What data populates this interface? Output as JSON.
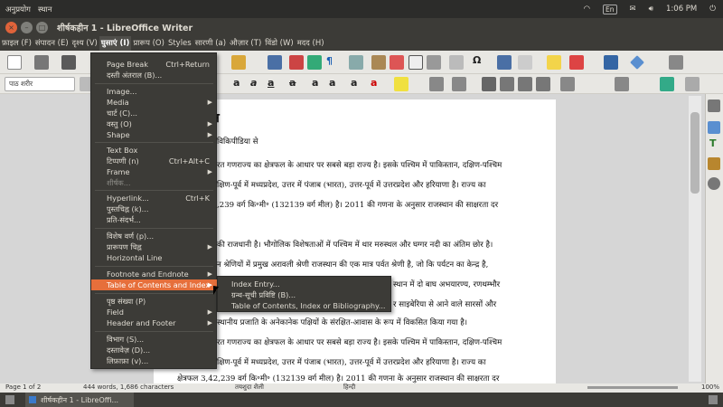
{
  "topbar": {
    "app_menu_1": "अनुप्रयोग",
    "app_menu_2": "स्थान",
    "keyboard": "En",
    "time": "1:06 PM"
  },
  "window": {
    "title": "शीर्षकहीन 1 - LibreOffice Writer"
  },
  "menubar": [
    "फ़ाइल (F)",
    "संपादन (E)",
    "दृश्य (V)",
    "घुसाएं (I)",
    "प्रारूप (O)",
    "Styles",
    "सारणी (a)",
    "औज़ार (T)",
    "विंडो (W)",
    "मदद (H)"
  ],
  "toolbar": {
    "paragraph_style": "पाठ शरीर"
  },
  "insert_menu": [
    {
      "label": "Page Break",
      "shortcut": "Ctrl+Return"
    },
    {
      "label": "दस्ती अंतराल (B)..."
    },
    {
      "label": "Image..."
    },
    {
      "label": "Media",
      "submenu": true
    },
    {
      "label": "चार्ट (C)..."
    },
    {
      "label": "वस्तु (O)",
      "submenu": true
    },
    {
      "label": "Shape",
      "submenu": true
    },
    {
      "label": "Text Box"
    },
    {
      "label": "टिप्पणी (n)",
      "shortcut": "Ctrl+Alt+C"
    },
    {
      "label": "Frame",
      "submenu": true
    },
    {
      "label": "शीर्षक...",
      "disabled": true
    },
    {
      "label": "Hyperlink...",
      "shortcut": "Ctrl+K"
    },
    {
      "label": "पुस्तचिह्न (k)..."
    },
    {
      "label": "प्रति-संदर्भ..."
    },
    {
      "label": "विशेष वर्ण (p)..."
    },
    {
      "label": "प्रारूपण चिह्न",
      "submenu": true
    },
    {
      "label": "Horizontal Line"
    },
    {
      "label": "Footnote and Endnote",
      "submenu": true
    },
    {
      "label": "Table of Contents and Index",
      "submenu": true,
      "highlighted": true
    },
    {
      "label": "पृष्ठ संख्या (P)"
    },
    {
      "label": "Field",
      "submenu": true
    },
    {
      "label": "Header and Footer",
      "submenu": true
    },
    {
      "label": "विभाग (S)..."
    },
    {
      "label": "दस्तावेज़ (D)..."
    },
    {
      "label": "लिफ़ाफ़ा (v)..."
    }
  ],
  "toc_submenu": [
    "Index Entry...",
    "ग्रन्थ-सूची प्रविष्टि (B)...",
    "Table of Contents, Index or Bibliography..."
  ],
  "document": {
    "heading": "न",
    "source": "विकिपीडिया से",
    "lines": [
      "रत गणराज्य का क्षेत्रफल के आधार पर सबसे बड़ा राज्य है। इसके पश्चिम में पाकिस्तान, दक्षिण-पश्चिम",
      "क्षिण-पूर्व में मध्यप्रदेश, उत्तर में पंजाब (भारत), उत्तर-पूर्व में उत्तरप्रदेश और हरियाणा है। राज्य का",
      ",239 वर्ग कि॰मी॰ (132139 वर्ग मील) है। 2011 की गणना के अनुसार राजस्थान की साक्षरता दर",
      "",
      "की राजधानी है। भौगोलिक विशेषताओं में पश्चिम में थार मरुस्थल और घग्गर नदी का अंतिम छोर है।",
      "न श्रेणियों में प्रमुख अरावली श्रेणी राजस्थान की एक मात्र पर्वत श्रेणी है, जो कि पर्यटन का केन्द्र है,",
      "स्थान में दो बाघ अभयारण्य, रणथम्भौर",
      "र साइबेरिया से आने वाले सारसों और",
      "स्थानीय प्रजाति के अनेकानेक पक्षियों के संरक्षित-आवास के रूप में विकसित किया गया है।",
      "रत गणराज्य का क्षेत्रफल के आधार पर सबसे बड़ा राज्य है। इसके पश्चिम में पाकिस्तान, दक्षिण-पश्चिम",
      "क्षिण-पूर्व में मध्यप्रदेश, उत्तर में पंजाब (भारत), उत्तर-पूर्व में उत्तरप्रदेश और हरियाणा है। राज्य का",
      "क्षेत्रफल 3,42,239 वर्ग कि॰मी॰ (132139 वर्ग मील) है। 2011 की गणना के अनुसार राजस्थान की साक्षरता दर"
    ]
  },
  "statusbar": {
    "page": "Page 1 of 2",
    "words": "444 words, 1,686 characters",
    "style": "तयशुदा शैली",
    "language": "हिन्दी",
    "zoom": "100%"
  },
  "taskbar": {
    "item": "शीर्षकहीन 1 - LibreOffi..."
  }
}
